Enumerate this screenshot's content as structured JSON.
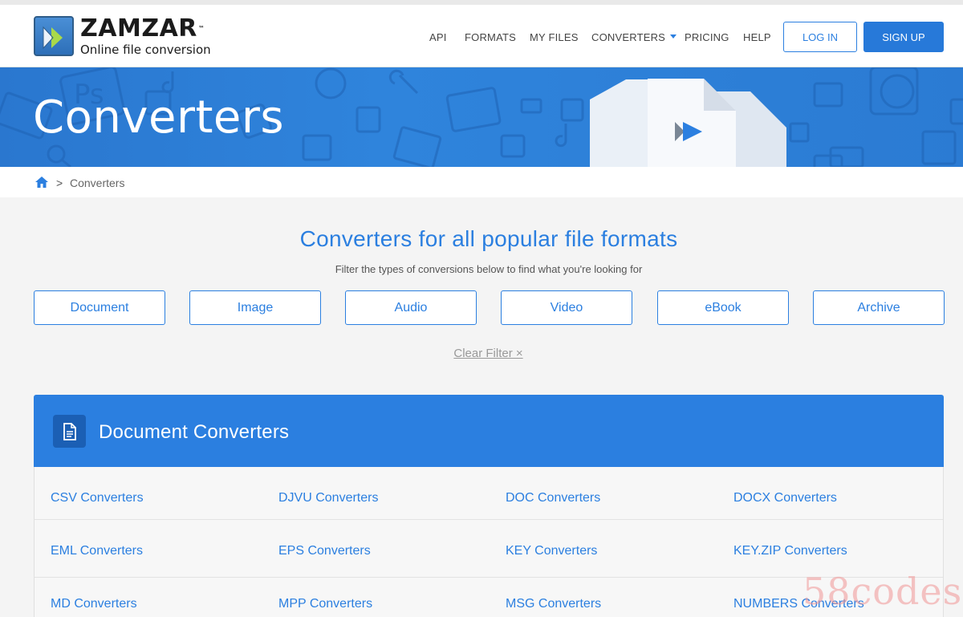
{
  "header": {
    "logo_name": "ZAMZAR",
    "logo_tm": "™",
    "logo_tagline": "Online file conversion",
    "nav": [
      "API",
      "FORMATS",
      "MY FILES",
      "CONVERTERS",
      "PRICING",
      "HELP"
    ],
    "login_label": "LOG IN",
    "signup_label": "SIGN UP"
  },
  "banner": {
    "title": "Converters"
  },
  "breadcrumb": {
    "separator": ">",
    "current": "Converters"
  },
  "main": {
    "title": "Converters for all popular file formats",
    "subtitle": "Filter the types of conversions below to find what you're looking for",
    "filters": [
      "Document",
      "Image",
      "Audio",
      "Video",
      "eBook",
      "Archive"
    ],
    "clear_filter": "Clear Filter ×"
  },
  "document_section": {
    "title": "Document Converters",
    "rows": [
      [
        "CSV Converters",
        "DJVU Converters",
        "DOC Converters",
        "DOCX Converters"
      ],
      [
        "EML Converters",
        "EPS Converters",
        "KEY Converters",
        "KEY.ZIP Converters"
      ],
      [
        "MD Converters",
        "MPP Converters",
        "MSG Converters",
        "NUMBERS Converters"
      ]
    ]
  },
  "watermark": "58codes",
  "colors": {
    "accent": "#2b7fe0",
    "banner": "#2f84dc",
    "signup": "#2779d9"
  }
}
